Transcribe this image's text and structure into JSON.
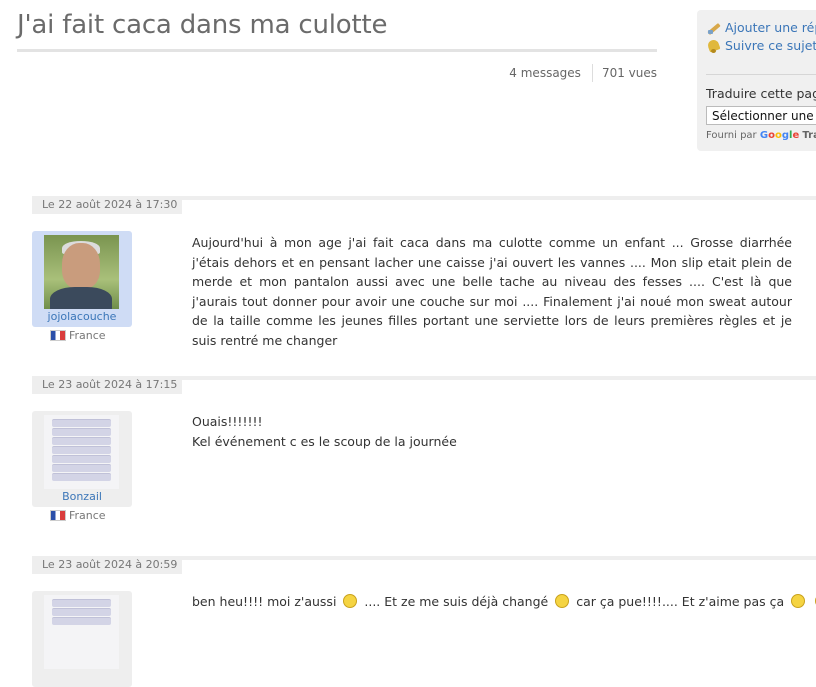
{
  "topic": {
    "title": "J'ai fait caca dans ma culotte",
    "messages": "4 messages",
    "views": "701 vues"
  },
  "sidebar": {
    "reply_link": "Ajouter une rép",
    "follow_link": "Suivre ce sujet",
    "translate_label": "Traduire cette page",
    "language_select": "Sélectionner une",
    "powered_by": "Fourni par",
    "google": [
      "G",
      "o",
      "o",
      "g",
      "l",
      "e"
    ],
    "translate_word": "Tra"
  },
  "posts": [
    {
      "date": "Le 22 août 2024 à 17:30",
      "author": "jojolacouche",
      "country": "France",
      "avatar": "portrait-photo",
      "lines": [
        "Aujourd'hui à mon age j'ai fait caca dans ma culotte comme un enfant ... Grosse diarrhée j'étais dehors et en pensant lacher une caisse j'ai ouvert les vannes .... Mon slip etait plein de merde et mon pantalon aussi avec une belle tache au niveau des fesses .... C'est là que j'aurais tout donner pour avoir une couche sur moi .... Finalement j'ai noué mon sweat autour de la taille comme les jeunes filles portant une serviette lors de leurs premières règles et je suis rentré me changer"
      ]
    },
    {
      "date": "Le 23 août 2024 à 17:15",
      "author": "Bonzail",
      "country": "France",
      "avatar": "towel-stack",
      "lines": [
        "Ouais!!!!!!!",
        "Kel événement c es le scoup de la journée"
      ]
    },
    {
      "date": "Le 23 août 2024 à 20:59",
      "author": "",
      "country": "",
      "avatar": "towel-stack",
      "text_parts": [
        "ben heu!!!! moi z'aussi",
        ".... Et ze me suis déjà changé",
        "car ça pue!!!!.... Et z'aime pas ça"
      ]
    }
  ]
}
